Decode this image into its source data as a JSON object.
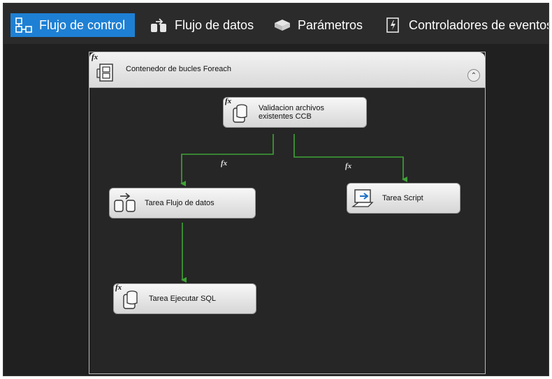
{
  "tabs": [
    {
      "label": "Flujo de control",
      "icon": "control-flow-icon",
      "active": true
    },
    {
      "label": "Flujo de datos",
      "icon": "data-flow-icon",
      "active": false
    },
    {
      "label": "Parámetros",
      "icon": "parameters-icon",
      "active": false
    },
    {
      "label": "Controladores de eventos",
      "icon": "event-handlers-icon",
      "active": false
    }
  ],
  "container": {
    "title": "Contenedor de bucles Foreach",
    "icon": "foreach-loop-icon",
    "collapse_symbol": "⌃"
  },
  "tasks": {
    "validation": {
      "line1": "Validacion archivos",
      "line2": "existentes CCB",
      "icon": "execute-sql-icon"
    },
    "dataflow": {
      "label": "Tarea Flujo de datos",
      "icon": "data-flow-task-icon"
    },
    "script": {
      "label": "Tarea Script",
      "icon": "script-task-icon"
    },
    "sql": {
      "label": "Tarea Ejecutar SQL",
      "icon": "execute-sql-icon"
    }
  },
  "fx_label": "fx",
  "colors": {
    "accent": "#1e80d4",
    "connector": "#3fa336",
    "canvas": "#202020"
  }
}
